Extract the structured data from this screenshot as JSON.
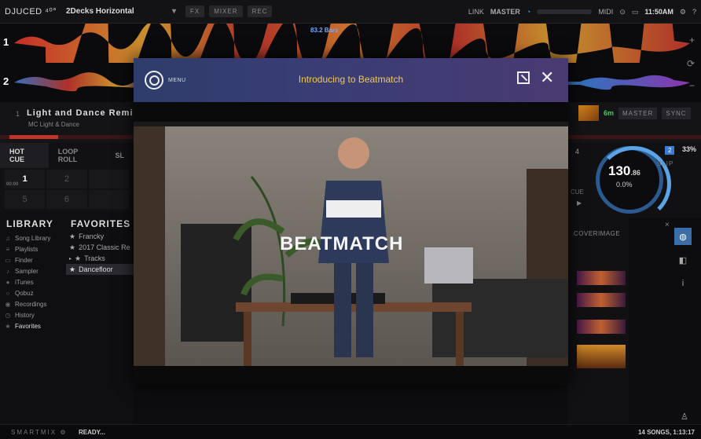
{
  "app": {
    "logo": "DJUCED ⁴⁰°",
    "layout": "2Decks Horizontal",
    "buttons": [
      "FX",
      "MIXER",
      "REC"
    ],
    "link": "LINK",
    "master": "MASTER",
    "midi": "MIDI",
    "clock": "11:50AM",
    "help": "?"
  },
  "waveform": {
    "deck1_num": "1",
    "deck2_num": "2",
    "bars_label": "83.2 Bars"
  },
  "deck1": {
    "title": "Light and Dance Remix",
    "artist": "MC Light & Dance",
    "num": "1",
    "progress": 0.07
  },
  "deck2": {
    "time": "6m",
    "buttons": [
      "MASTER",
      "SYNC"
    ],
    "bpm_main": "130",
    "bpm_dec": ".86",
    "pitch": "0.0%",
    "deck_num": "2",
    "pct": "33%",
    "slip": "SLIP",
    "cue": "CUE",
    "four": "4"
  },
  "pads": {
    "tabs": [
      "HOT CUE",
      "LOOP ROLL",
      "SL"
    ],
    "cells": [
      "1",
      "2",
      "",
      "5",
      "6",
      ""
    ],
    "timestamp": "00:00"
  },
  "library": {
    "heading": "LIBRARY",
    "items": [
      {
        "label": "Song Library",
        "icon": "♫"
      },
      {
        "label": "Playlists",
        "icon": "≡"
      },
      {
        "label": "Finder",
        "icon": "▭"
      },
      {
        "label": "Sampler",
        "icon": "♪"
      },
      {
        "label": "iTunes",
        "icon": "●"
      },
      {
        "label": "Qobuz",
        "icon": "○"
      },
      {
        "label": "Recordings",
        "icon": "◉"
      },
      {
        "label": "History",
        "icon": "◷"
      },
      {
        "label": "Favorites",
        "icon": "★"
      }
    ]
  },
  "favorites": {
    "heading": "FAVORITES",
    "items": [
      "Francky",
      "2017 Classic Re",
      "Tracks",
      "Dancefloor"
    ]
  },
  "cover": {
    "heading": "COVERIMAGE",
    "close": "×"
  },
  "footer": {
    "smartmix": "SMARTMIX",
    "status": "READY...",
    "songs": "14 SONGS, 1:13:17"
  },
  "modal": {
    "menu_label": "MENU",
    "title": "Introducing to Beatmatch",
    "close": "✕",
    "video_caption": "BEATMATCH"
  },
  "colors": {
    "accent_blue": "#3b6ea8",
    "title_yellow": "#f2c94c",
    "deck_red": "#c0352b",
    "green": "#3ad05a"
  }
}
